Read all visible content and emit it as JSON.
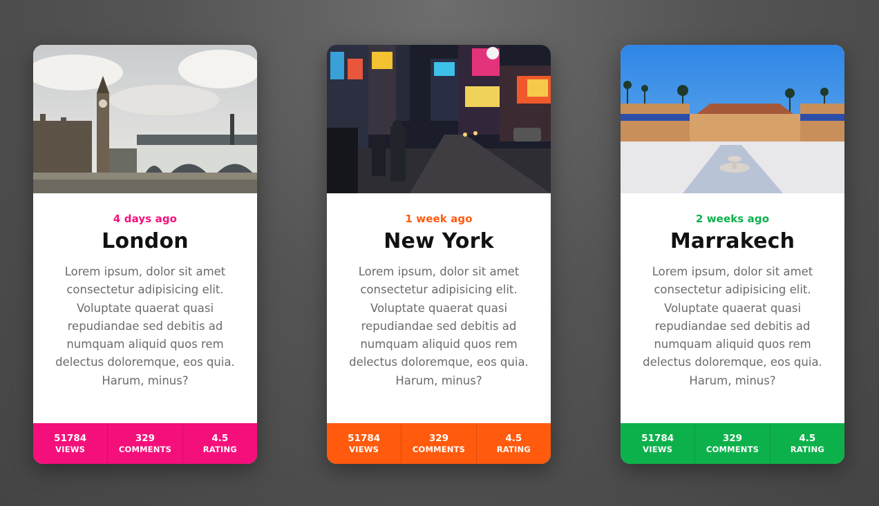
{
  "colors": {
    "pink": "#f50f7b",
    "orange": "#ff5a0d",
    "green": "#0db14b"
  },
  "cards": [
    {
      "date": "4 days ago",
      "city": "London",
      "description": "Lorem ipsum, dolor sit amet consectetur adipisicing elit. Voluptate quaerat quasi repudiandae sed debitis ad numquam aliquid quos rem delectus doloremque, eos quia. Harum, minus?",
      "accent": "#f50f7b",
      "image": "london-big-ben-photo",
      "stats": [
        {
          "value": "51784",
          "label": "VIEWS"
        },
        {
          "value": "329",
          "label": "COMMENTS"
        },
        {
          "value": "4.5",
          "label": "RATING"
        }
      ]
    },
    {
      "date": "1 week ago",
      "city": "New York",
      "description": "Lorem ipsum, dolor sit amet consectetur adipisicing elit. Voluptate quaerat quasi repudiandae sed debitis ad numquam aliquid quos rem delectus doloremque, eos quia. Harum, minus?",
      "accent": "#ff5a0d",
      "image": "new-york-times-square-photo",
      "stats": [
        {
          "value": "51784",
          "label": "VIEWS"
        },
        {
          "value": "329",
          "label": "COMMENTS"
        },
        {
          "value": "4.5",
          "label": "RATING"
        }
      ]
    },
    {
      "date": "2 weeks ago",
      "city": "Marrakech",
      "description": "Lorem ipsum, dolor sit amet consectetur adipisicing elit. Voluptate quaerat quasi repudiandae sed debitis ad numquam aliquid quos rem delectus doloremque, eos quia. Harum, minus?",
      "accent": "#0db14b",
      "image": "marrakech-palace-courtyard-photo",
      "stats": [
        {
          "value": "51784",
          "label": "VIEWS"
        },
        {
          "value": "329",
          "label": "COMMENTS"
        },
        {
          "value": "4.5",
          "label": "RATING"
        }
      ]
    }
  ]
}
